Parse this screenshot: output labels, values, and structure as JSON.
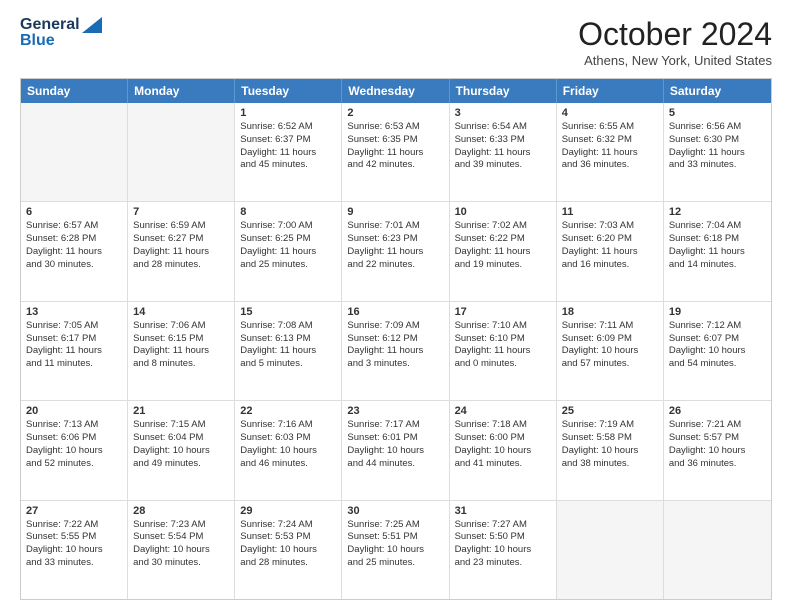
{
  "logo": {
    "line1": "General",
    "line2": "Blue"
  },
  "title": "October 2024",
  "location": "Athens, New York, United States",
  "days_of_week": [
    "Sunday",
    "Monday",
    "Tuesday",
    "Wednesday",
    "Thursday",
    "Friday",
    "Saturday"
  ],
  "weeks": [
    [
      {
        "day": "",
        "lines": []
      },
      {
        "day": "",
        "lines": []
      },
      {
        "day": "1",
        "lines": [
          "Sunrise: 6:52 AM",
          "Sunset: 6:37 PM",
          "Daylight: 11 hours",
          "and 45 minutes."
        ]
      },
      {
        "day": "2",
        "lines": [
          "Sunrise: 6:53 AM",
          "Sunset: 6:35 PM",
          "Daylight: 11 hours",
          "and 42 minutes."
        ]
      },
      {
        "day": "3",
        "lines": [
          "Sunrise: 6:54 AM",
          "Sunset: 6:33 PM",
          "Daylight: 11 hours",
          "and 39 minutes."
        ]
      },
      {
        "day": "4",
        "lines": [
          "Sunrise: 6:55 AM",
          "Sunset: 6:32 PM",
          "Daylight: 11 hours",
          "and 36 minutes."
        ]
      },
      {
        "day": "5",
        "lines": [
          "Sunrise: 6:56 AM",
          "Sunset: 6:30 PM",
          "Daylight: 11 hours",
          "and 33 minutes."
        ]
      }
    ],
    [
      {
        "day": "6",
        "lines": [
          "Sunrise: 6:57 AM",
          "Sunset: 6:28 PM",
          "Daylight: 11 hours",
          "and 30 minutes."
        ]
      },
      {
        "day": "7",
        "lines": [
          "Sunrise: 6:59 AM",
          "Sunset: 6:27 PM",
          "Daylight: 11 hours",
          "and 28 minutes."
        ]
      },
      {
        "day": "8",
        "lines": [
          "Sunrise: 7:00 AM",
          "Sunset: 6:25 PM",
          "Daylight: 11 hours",
          "and 25 minutes."
        ]
      },
      {
        "day": "9",
        "lines": [
          "Sunrise: 7:01 AM",
          "Sunset: 6:23 PM",
          "Daylight: 11 hours",
          "and 22 minutes."
        ]
      },
      {
        "day": "10",
        "lines": [
          "Sunrise: 7:02 AM",
          "Sunset: 6:22 PM",
          "Daylight: 11 hours",
          "and 19 minutes."
        ]
      },
      {
        "day": "11",
        "lines": [
          "Sunrise: 7:03 AM",
          "Sunset: 6:20 PM",
          "Daylight: 11 hours",
          "and 16 minutes."
        ]
      },
      {
        "day": "12",
        "lines": [
          "Sunrise: 7:04 AM",
          "Sunset: 6:18 PM",
          "Daylight: 11 hours",
          "and 14 minutes."
        ]
      }
    ],
    [
      {
        "day": "13",
        "lines": [
          "Sunrise: 7:05 AM",
          "Sunset: 6:17 PM",
          "Daylight: 11 hours",
          "and 11 minutes."
        ]
      },
      {
        "day": "14",
        "lines": [
          "Sunrise: 7:06 AM",
          "Sunset: 6:15 PM",
          "Daylight: 11 hours",
          "and 8 minutes."
        ]
      },
      {
        "day": "15",
        "lines": [
          "Sunrise: 7:08 AM",
          "Sunset: 6:13 PM",
          "Daylight: 11 hours",
          "and 5 minutes."
        ]
      },
      {
        "day": "16",
        "lines": [
          "Sunrise: 7:09 AM",
          "Sunset: 6:12 PM",
          "Daylight: 11 hours",
          "and 3 minutes."
        ]
      },
      {
        "day": "17",
        "lines": [
          "Sunrise: 7:10 AM",
          "Sunset: 6:10 PM",
          "Daylight: 11 hours",
          "and 0 minutes."
        ]
      },
      {
        "day": "18",
        "lines": [
          "Sunrise: 7:11 AM",
          "Sunset: 6:09 PM",
          "Daylight: 10 hours",
          "and 57 minutes."
        ]
      },
      {
        "day": "19",
        "lines": [
          "Sunrise: 7:12 AM",
          "Sunset: 6:07 PM",
          "Daylight: 10 hours",
          "and 54 minutes."
        ]
      }
    ],
    [
      {
        "day": "20",
        "lines": [
          "Sunrise: 7:13 AM",
          "Sunset: 6:06 PM",
          "Daylight: 10 hours",
          "and 52 minutes."
        ]
      },
      {
        "day": "21",
        "lines": [
          "Sunrise: 7:15 AM",
          "Sunset: 6:04 PM",
          "Daylight: 10 hours",
          "and 49 minutes."
        ]
      },
      {
        "day": "22",
        "lines": [
          "Sunrise: 7:16 AM",
          "Sunset: 6:03 PM",
          "Daylight: 10 hours",
          "and 46 minutes."
        ]
      },
      {
        "day": "23",
        "lines": [
          "Sunrise: 7:17 AM",
          "Sunset: 6:01 PM",
          "Daylight: 10 hours",
          "and 44 minutes."
        ]
      },
      {
        "day": "24",
        "lines": [
          "Sunrise: 7:18 AM",
          "Sunset: 6:00 PM",
          "Daylight: 10 hours",
          "and 41 minutes."
        ]
      },
      {
        "day": "25",
        "lines": [
          "Sunrise: 7:19 AM",
          "Sunset: 5:58 PM",
          "Daylight: 10 hours",
          "and 38 minutes."
        ]
      },
      {
        "day": "26",
        "lines": [
          "Sunrise: 7:21 AM",
          "Sunset: 5:57 PM",
          "Daylight: 10 hours",
          "and 36 minutes."
        ]
      }
    ],
    [
      {
        "day": "27",
        "lines": [
          "Sunrise: 7:22 AM",
          "Sunset: 5:55 PM",
          "Daylight: 10 hours",
          "and 33 minutes."
        ]
      },
      {
        "day": "28",
        "lines": [
          "Sunrise: 7:23 AM",
          "Sunset: 5:54 PM",
          "Daylight: 10 hours",
          "and 30 minutes."
        ]
      },
      {
        "day": "29",
        "lines": [
          "Sunrise: 7:24 AM",
          "Sunset: 5:53 PM",
          "Daylight: 10 hours",
          "and 28 minutes."
        ]
      },
      {
        "day": "30",
        "lines": [
          "Sunrise: 7:25 AM",
          "Sunset: 5:51 PM",
          "Daylight: 10 hours",
          "and 25 minutes."
        ]
      },
      {
        "day": "31",
        "lines": [
          "Sunrise: 7:27 AM",
          "Sunset: 5:50 PM",
          "Daylight: 10 hours",
          "and 23 minutes."
        ]
      },
      {
        "day": "",
        "lines": []
      },
      {
        "day": "",
        "lines": []
      }
    ]
  ]
}
